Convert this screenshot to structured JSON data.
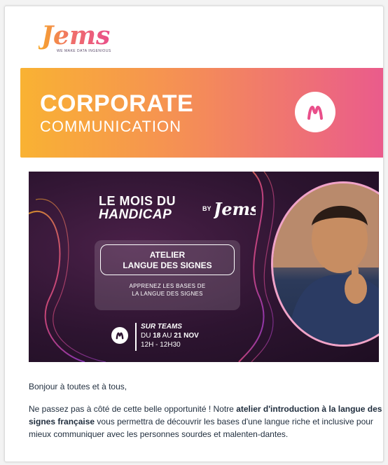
{
  "header": {
    "logo_text": "Jems",
    "logo_tagline": "WE MAKE DATA INGENIOUS"
  },
  "banner": {
    "title": "CORPORATE",
    "subtitle": "COMMUNICATION",
    "badge_icon": "jems-m-icon"
  },
  "event": {
    "heading_line1": "LE MOIS DU",
    "heading_line2": "HANDICAP",
    "by": "BY",
    "brand": "Jems",
    "workshop_line1": "ATELIER",
    "workshop_line2": "LANGUE DES SIGNES",
    "desc_line1": "APPRENEZ LES BASES DE",
    "desc_line2": "LA LANGUE DES SIGNES",
    "where": "SUR TEAMS",
    "date_prefix": "DU ",
    "date_start": "18",
    "date_mid": " AU ",
    "date_end": "21 NOV",
    "time": "12H - 12H30"
  },
  "body": {
    "greeting": "Bonjour à toutes et à tous,",
    "p1_a": "Ne passez pas à côté de cette belle opportunité ! Notre ",
    "p1_b": "atelier d'introduction à la langue des signes française",
    "p1_c": " vous permettra de découvrir les bases d'une langue riche et inclusive pour mieux communiquer avec les personnes sourdes et malenten-dantes."
  },
  "colors": {
    "banner_start": "#f9b233",
    "banner_end": "#ea5b8c",
    "event_bg": "#2d1430",
    "accent_pink": "#e94f8a",
    "text": "#1f2d3d"
  }
}
